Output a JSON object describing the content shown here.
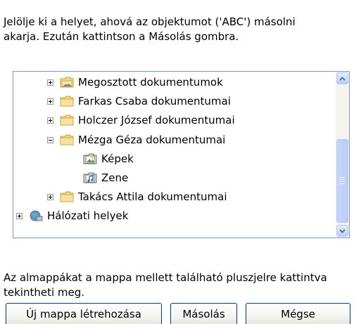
{
  "instruction_text": "Jelölje ki a helyet, ahová az objektumot ('ABC') másolni\nakarja. Ezután kattintson a Másolás gombra.",
  "tree": {
    "items": [
      {
        "label": "Megosztott dokumentumok",
        "expander": "plus",
        "icon": "shared-folder-icon"
      },
      {
        "label": "Farkas Csaba dokumentumai",
        "expander": "plus",
        "icon": "folder-icon"
      },
      {
        "label": "Holczer József dokumentumai",
        "expander": "plus",
        "icon": "folder-icon"
      },
      {
        "label": "Mézga Géza dokumentumai",
        "expander": "minus",
        "icon": "folder-open-icon"
      },
      {
        "label": "Képek",
        "expander": "none",
        "icon": "pictures-folder-icon"
      },
      {
        "label": "Zene",
        "expander": "none",
        "icon": "music-folder-icon"
      },
      {
        "label": "Takács Attila dokumentumai",
        "expander": "plus",
        "icon": "folder-icon"
      },
      {
        "label": "Hálózati helyek",
        "expander": "plus",
        "icon": "network-places-icon"
      }
    ]
  },
  "hint_text": "Az almappákat a mappa mellett található pluszjelre kattintva\ntekintheti meg.",
  "buttons": {
    "new_folder": "Új mappa létrehozása",
    "copy": "Másolás",
    "cancel": "Mégse"
  },
  "colors": {
    "folder": "#f1d77f",
    "folder_edge": "#c5a044",
    "border": "#7f9db9",
    "button_border": "#003c74"
  }
}
